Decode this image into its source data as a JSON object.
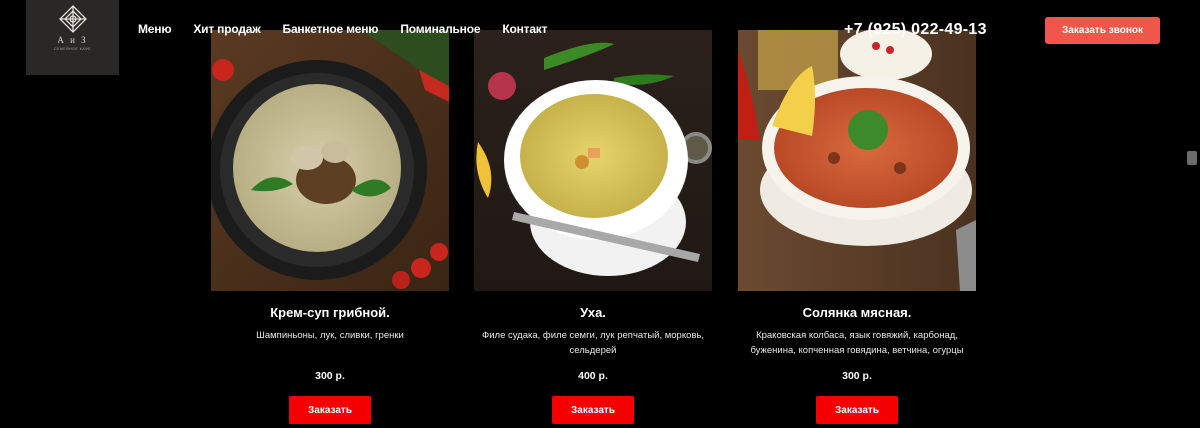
{
  "header": {
    "logo_text": "А и З",
    "logo_tagline": "СЕМЕЙНОЕ КАФЕ",
    "nav": [
      "Меню",
      "Хит продаж",
      "Банкетное меню",
      "Поминальное",
      "Контакт"
    ],
    "phone": "+7 (925) 022-49-13",
    "callback_label": "Заказать звонок"
  },
  "products": [
    {
      "title": "Крем-суп грибной.",
      "desc": "Шампиньоны, лук, сливки, гренки",
      "price": "300 р.",
      "button": "Заказать"
    },
    {
      "title": "Уха.",
      "desc": "Филе судака, филе семги, лук репчатый, морковь, сельдерей",
      "price": "400 р.",
      "button": "Заказать"
    },
    {
      "title": "Солянка мясная.",
      "desc": "Краковская колбаса, язык говяжий, карбонад, буженина, копченная говядина, ветчина, огурцы",
      "price": "300 р.",
      "button": "Заказать"
    }
  ],
  "colors": {
    "accent_order": "#f40000",
    "accent_callback": "#f0574a",
    "background": "#000000"
  }
}
